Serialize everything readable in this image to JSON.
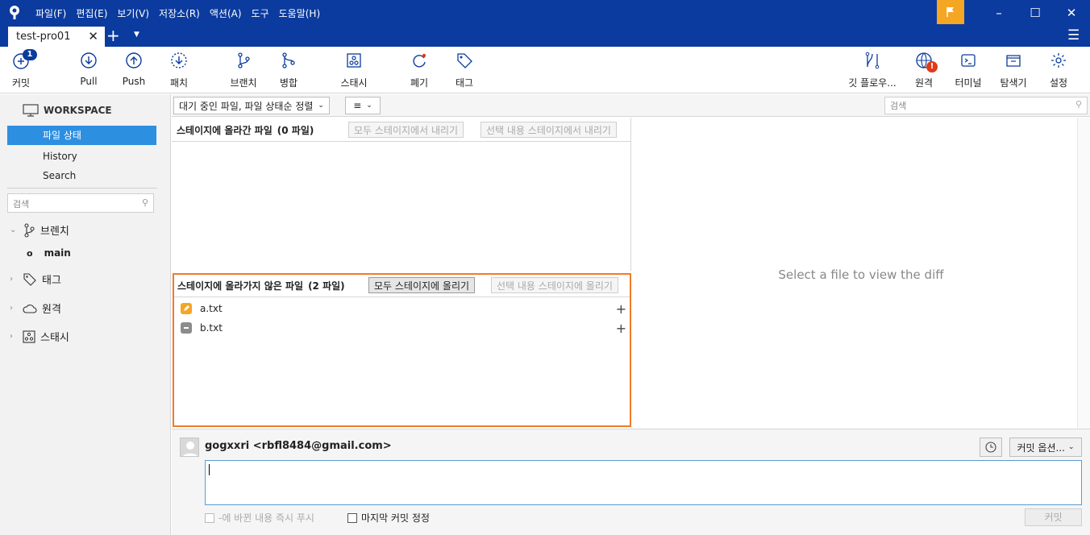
{
  "menu": [
    "파일(F)",
    "편집(E)",
    "보기(V)",
    "저장소(R)",
    "액션(A)",
    "도구",
    "도움말(H)"
  ],
  "tab": {
    "title": "test-pro01"
  },
  "toolbar": {
    "commit": "커밋",
    "commit_badge": "1",
    "pull": "Pull",
    "push": "Push",
    "patch": "패치",
    "branch": "브랜치",
    "merge": "병합",
    "stash": "스태시",
    "discard": "폐기",
    "tag": "태그",
    "gitflow": "깃 플로우...",
    "remote": "원격",
    "remote_badge": "!",
    "terminal": "터미널",
    "explorer": "탐색기",
    "settings": "설정"
  },
  "sidebar": {
    "workspace": "WORKSPACE",
    "items": [
      {
        "label": "파일 상태",
        "active": true
      },
      {
        "label": "History"
      },
      {
        "label": "Search"
      }
    ],
    "search_placeholder": "검색",
    "branches_label": "브렌치",
    "branch_main": "main",
    "tags_label": "태그",
    "remotes_label": "원격",
    "stashes_label": "스태시"
  },
  "filter": {
    "sort": "대기 중인 파일, 파일 상태순 정렬",
    "view_icon": "list-icon",
    "search_placeholder": "검색"
  },
  "staged": {
    "title": "스테이지에 올라간 파일",
    "count": "(0 파일)",
    "unstage_all": "모두 스테이지에서 내리기",
    "unstage_selected": "선택 내용 스테이지에서 내리기"
  },
  "unstaged": {
    "title": "스테이지에 올라가지 않은 파일",
    "count": "(2 파일)",
    "stage_all": "모두 스테이지에 올리기",
    "stage_selected": "선택 내용 스테이지에 올리기",
    "files": [
      {
        "name": "a.txt",
        "status": "modified",
        "color": "#f5a623"
      },
      {
        "name": "b.txt",
        "status": "missing",
        "color": "#8c8c8c"
      }
    ]
  },
  "diff": {
    "placeholder": "Select a file to view the diff"
  },
  "commit": {
    "author": "gogxxri <rbfl8484@gmail.com>",
    "options": "커밋 옵션...",
    "push_immediately": "-에 바뀐 내용 즉시 푸시",
    "amend": "마지막 커밋 정정",
    "button": "커밋"
  },
  "colors": {
    "titlebar": "#0b3b9e",
    "accent": "#2d8fe0",
    "highlight": "#ef7b2a",
    "flag": "#f5a623"
  }
}
